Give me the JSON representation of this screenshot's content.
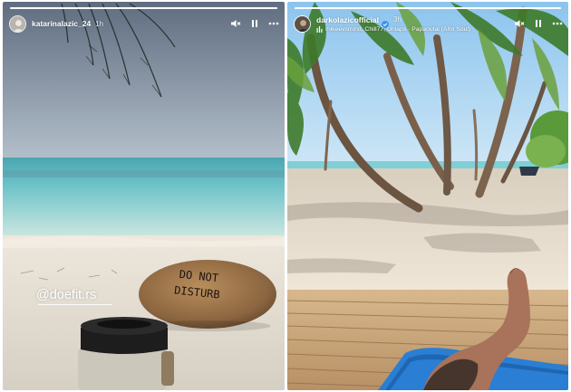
{
  "stories": [
    {
      "username": "katarinalazic_24",
      "time": "1h",
      "verified": false,
      "progress": 1.0,
      "mention": "@doefit.rs",
      "stone_text_line1": "DO NOT",
      "stone_text_line2": "DISTURB",
      "icons": [
        "mute-icon",
        "pause-icon",
        "more-icon"
      ]
    },
    {
      "username": "darkolazicofficial",
      "time": "3h",
      "verified": true,
      "progress": 1.0,
      "music": "mikeevsmind, Chill77, Uniaps · Papaoutai (Afro Soul)",
      "icons": [
        "mute-icon",
        "pause-icon",
        "more-icon"
      ]
    }
  ],
  "colors": {
    "sky_left": "#7d8a9a",
    "sea_turquoise": "#6fc3c9",
    "sand": "#e8e0d4",
    "sky_right": "#9fd0f4",
    "deck_wood": "#c8a67a",
    "lounger_blue": "#2a7fd4"
  }
}
